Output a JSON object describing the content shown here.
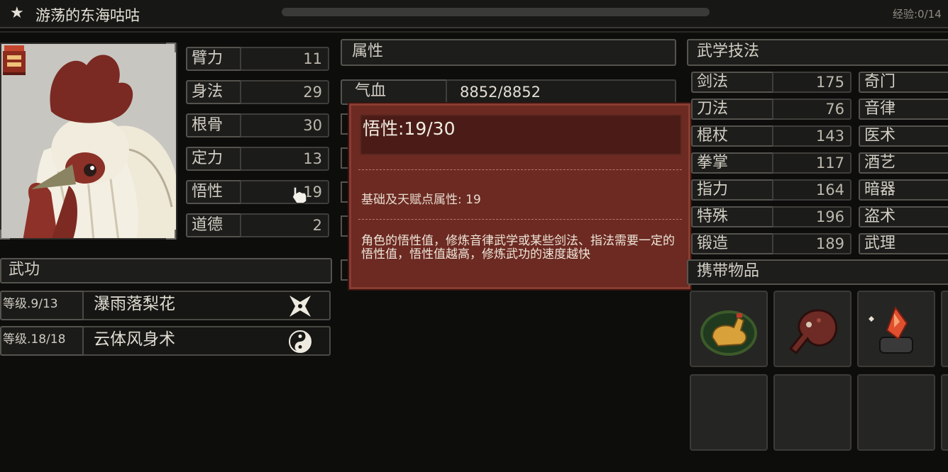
{
  "header": {
    "star": "★",
    "name": "游荡的东海咕咕",
    "xp": "经验:0/14"
  },
  "stats": [
    {
      "label": "臂力",
      "value": "11"
    },
    {
      "label": "身法",
      "value": "29"
    },
    {
      "label": "根骨",
      "value": "30"
    },
    {
      "label": "定力",
      "value": "13"
    },
    {
      "label": "悟性",
      "value": "19"
    },
    {
      "label": "道德",
      "value": "2"
    }
  ],
  "attributes": {
    "title": "属性",
    "hp_label": "气血",
    "hp_value": "8852/8852"
  },
  "tooltip": {
    "title": "悟性:19/30",
    "base": "基础及天赋点属性: 19",
    "description": "角色的悟性值，修炼音律武学或某些剑法、指法需要一定的悟性值，悟性值越高，修炼武功的速度越快"
  },
  "martial_skills": {
    "title": "武学技法",
    "left": [
      {
        "label": "剑法",
        "value": "175"
      },
      {
        "label": "刀法",
        "value": "76"
      },
      {
        "label": "棍杖",
        "value": "143"
      },
      {
        "label": "拳掌",
        "value": "117"
      },
      {
        "label": "指力",
        "value": "164"
      },
      {
        "label": "特殊",
        "value": "196"
      },
      {
        "label": "锻造",
        "value": "189"
      }
    ],
    "right": [
      "奇门",
      "音律",
      "医术",
      "酒艺",
      "暗器",
      "盗术",
      "武理"
    ]
  },
  "wugong": {
    "title": "武功",
    "rows": [
      {
        "level": "等级.9/13",
        "name": "瀑雨落梨花",
        "icon": "shuriken-icon"
      },
      {
        "level": "等级.18/18",
        "name": "云体风身术",
        "icon": "yin-yang-icon"
      }
    ]
  },
  "items": {
    "title": "携带物品",
    "slots": [
      "golden-rooster-icon",
      "drumstick-icon",
      "fire-crystal-icon",
      "empty",
      "empty",
      "empty"
    ]
  },
  "colors": {
    "tooltip_bg": "#6c2a22",
    "background": "#0d0d0c",
    "panel": "#1d1d1b"
  }
}
